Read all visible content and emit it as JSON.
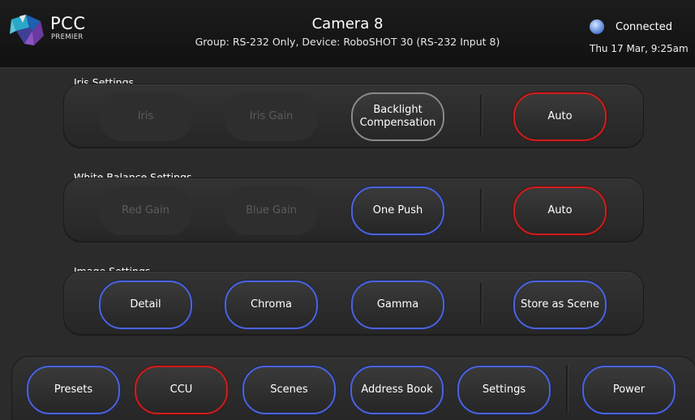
{
  "header": {
    "logo_text": "PCC",
    "logo_sub": "PREMIER",
    "title": "Camera 8",
    "subtitle": "Group: RS-232 Only,  Device: RoboSHOT 30 (RS-232 Input 8)",
    "status_text": "Connected",
    "datetime": "Thu 17 Mar, 9:25am",
    "status_color": "#7fa2e6"
  },
  "iris": {
    "label": "Iris Settings",
    "iris": "Iris",
    "iris_gain": "Iris Gain",
    "backlight": "Backlight Compensation",
    "auto": "Auto"
  },
  "white_balance": {
    "label": "White Balance Settings",
    "red_gain": "Red Gain",
    "blue_gain": "Blue Gain",
    "one_push": "One Push",
    "auto": "Auto"
  },
  "image": {
    "label": "Image Settings",
    "detail": "Detail",
    "chroma": "Chroma",
    "gamma": "Gamma",
    "store_scene": "Store as Scene"
  },
  "nav": {
    "presets": "Presets",
    "ccu": "CCU",
    "scenes": "Scenes",
    "address_book": "Address Book",
    "settings": "Settings",
    "power": "Power"
  },
  "colors": {
    "accent_blue": "#4c63d8",
    "accent_red": "#cc1f1f",
    "background": "#2b2b2b"
  }
}
